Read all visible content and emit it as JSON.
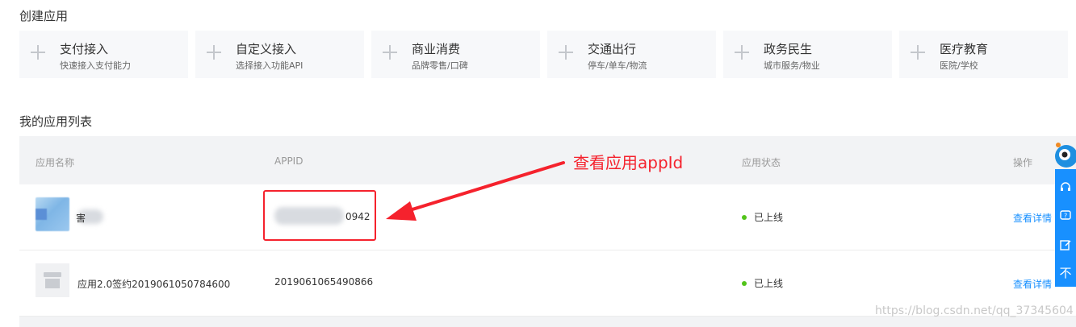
{
  "create_section": {
    "title": "创建应用",
    "cards": [
      {
        "title": "支付接入",
        "subtitle": "快速接入支付能力"
      },
      {
        "title": "自定义接入",
        "subtitle": "选择接入功能API"
      },
      {
        "title": "商业消费",
        "subtitle": "品牌零售/口碑"
      },
      {
        "title": "交通出行",
        "subtitle": "停车/单车/物流"
      },
      {
        "title": "政务民生",
        "subtitle": "城市服务/物业"
      },
      {
        "title": "医疗教育",
        "subtitle": "医院/学校"
      }
    ]
  },
  "app_list": {
    "title": "我的应用列表",
    "columns": [
      "应用名称",
      "APPID",
      "应用状态",
      "操作"
    ],
    "rows": [
      {
        "name": "        ",
        "name_visible_fragment": "害",
        "appid_visible_suffix": "0942",
        "status": "已上线",
        "action": "查看详情"
      },
      {
        "name": "应用2.0签约2019061050784600",
        "appid": "2019061065490866",
        "status": "已上线",
        "action": "查看详情"
      }
    ]
  },
  "annotation": {
    "text": "查看应用appId",
    "color": "#f5222d"
  },
  "sidebar": {
    "icons": [
      "headset-icon",
      "help-icon",
      "edit-icon",
      "back-to-top-icon"
    ],
    "top_label": "不"
  },
  "watermark": "https://blog.csdn.net/qq_37345604",
  "colors": {
    "accent": "#1890ff",
    "status_online": "#52c41a",
    "highlight": "#f5222d"
  }
}
